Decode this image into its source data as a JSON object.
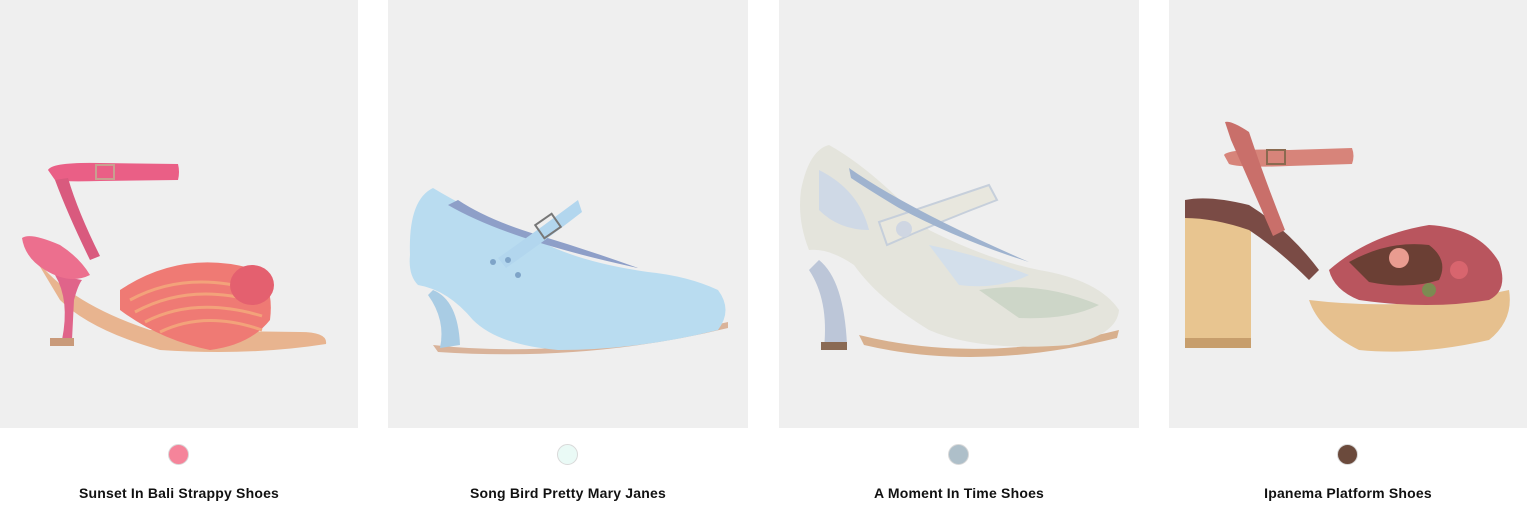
{
  "products": [
    {
      "name": "Sunset In Bali Strappy Shoes",
      "swatch_color": "#f5849a",
      "image_icon": "shoe-image"
    },
    {
      "name": "Song Bird Pretty Mary Janes",
      "swatch_color": "#eafaf6",
      "image_icon": "shoe-image"
    },
    {
      "name": "A Moment In Time Shoes",
      "swatch_color": "#aebfc9",
      "image_icon": "shoe-image"
    },
    {
      "name": "Ipanema Platform Shoes",
      "swatch_color": "#6b4a3c",
      "image_icon": "shoe-image"
    }
  ],
  "colors": {
    "photo_background": "#efefef",
    "text": "#111111"
  }
}
